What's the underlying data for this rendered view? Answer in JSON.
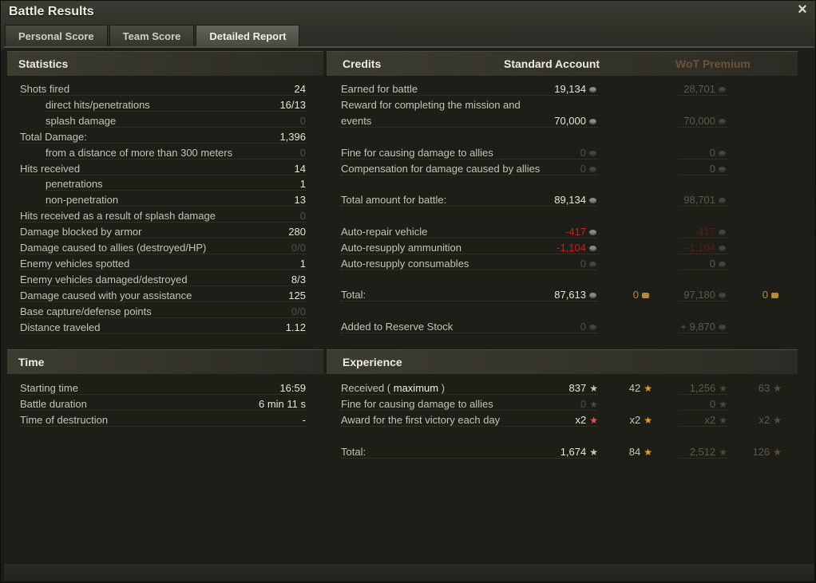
{
  "window": {
    "title": "Battle Results",
    "close_icon": "×"
  },
  "tabs": [
    "Personal Score",
    "Team Score",
    "Detailed Report"
  ],
  "statistics": {
    "title": "Statistics",
    "rows": [
      {
        "label": "Shots fired",
        "value": "24",
        "indent": false,
        "dim": false
      },
      {
        "label": "direct hits/penetrations",
        "value": "16/13",
        "indent": true,
        "dim": false
      },
      {
        "label": "splash damage",
        "value": "0",
        "indent": true,
        "dim": true
      },
      {
        "label": "Total Damage:",
        "value": "1,396",
        "indent": false,
        "dim": false
      },
      {
        "label": "from a distance of more than 300 meters",
        "value": "0",
        "indent": true,
        "dim": true
      },
      {
        "label": "Hits received",
        "value": "14",
        "indent": false,
        "dim": false
      },
      {
        "label": "penetrations",
        "value": "1",
        "indent": true,
        "dim": false
      },
      {
        "label": "non-penetration",
        "value": "13",
        "indent": true,
        "dim": false
      },
      {
        "label": "Hits received as a result of splash damage",
        "value": "0",
        "indent": false,
        "dim": true
      },
      {
        "label": "Damage blocked by armor",
        "value": "280",
        "indent": false,
        "dim": false
      },
      {
        "label": "Damage caused to allies (destroyed/HP)",
        "value": "0/0",
        "indent": false,
        "dim": true
      },
      {
        "label": "Enemy vehicles spotted",
        "value": "1",
        "indent": false,
        "dim": false
      },
      {
        "label": "Enemy vehicles damaged/destroyed",
        "value": "8/3",
        "indent": false,
        "dim": false
      },
      {
        "label": "Damage caused with your assistance",
        "value": "125",
        "indent": false,
        "dim": false
      },
      {
        "label": "Base capture/defense points",
        "value": "0/0",
        "indent": false,
        "dim": true
      },
      {
        "label": "Distance traveled",
        "value": "1.12",
        "indent": false,
        "dim": false
      }
    ]
  },
  "time": {
    "title": "Time",
    "rows": [
      {
        "label": "Starting time",
        "value": "16:59"
      },
      {
        "label": "Battle duration",
        "value": "6 min 11 s"
      },
      {
        "label": "Time of destruction",
        "value": "-"
      }
    ]
  },
  "credits": {
    "title": "Credits",
    "standard_header": "Standard Account",
    "premium_header": "WoT Premium",
    "rows": [
      {
        "label": "Earned for battle",
        "std": "19,134",
        "prem": "28,701",
        "std_style": "bright",
        "prem_style": "fade"
      },
      {
        "label": "Reward for completing the mission and",
        "label2": "events",
        "std": "70,000",
        "prem": "70,000",
        "std_style": "bright",
        "prem_style": "fade"
      },
      {
        "label": "Fine for causing damage to allies",
        "std": "0",
        "prem": "0",
        "std_style": "dim",
        "prem_style": "fade"
      },
      {
        "label": "Compensation for damage caused by allies",
        "std": "0",
        "prem": "0",
        "std_style": "dim",
        "prem_style": "fade"
      },
      {
        "label": "Total amount for battle:",
        "std": "89,134",
        "prem": "98,701",
        "std_style": "bright",
        "prem_style": "fade"
      },
      {
        "label": "Auto-repair vehicle",
        "std": "-417",
        "prem": "-417",
        "std_style": "red",
        "prem_style": "redfade"
      },
      {
        "label": "Auto-resupply ammunition",
        "std": "-1,104",
        "prem": "-1,104",
        "std_style": "red",
        "prem_style": "redfade"
      },
      {
        "label": "Auto-resupply consumables",
        "std": "0",
        "prem": "0",
        "std_style": "dim",
        "prem_style": "fade"
      },
      {
        "label": "Total:",
        "std": "87,613",
        "std_gold": "0",
        "prem": "97,180",
        "prem_gold": "0",
        "std_style": "bright",
        "prem_style": "fade"
      },
      {
        "label": "Added to Reserve Stock",
        "std": "0",
        "prem": "+ 9,870",
        "std_style": "dim",
        "prem_style": "fade"
      }
    ]
  },
  "experience": {
    "title": "Experience",
    "received_label_prefix": "Received ( ",
    "received_label_bold": "maximum",
    "received_label_suffix": " )",
    "rows": [
      {
        "label": "Received",
        "std_xp": "837",
        "std_free": "42",
        "prem_xp": "1,256",
        "prem_free": "63"
      },
      {
        "label": "Fine for causing damage to allies",
        "std_xp": "0",
        "prem_xp": "0"
      },
      {
        "label": "Award for the first victory each day",
        "std_xp": "x2",
        "std_free": "x2",
        "prem_xp": "x2",
        "prem_free": "x2"
      },
      {
        "label": "Total:",
        "std_xp": "1,674",
        "std_free": "84",
        "prem_xp": "2,512",
        "prem_free": "126"
      }
    ]
  },
  "icons": {
    "credit": "credit-icon",
    "gold": "gold-icon",
    "xp_star": "star-icon"
  },
  "colors": {
    "red": "#d61b10",
    "gold": "#f0a000",
    "premium": "#6b5535"
  }
}
